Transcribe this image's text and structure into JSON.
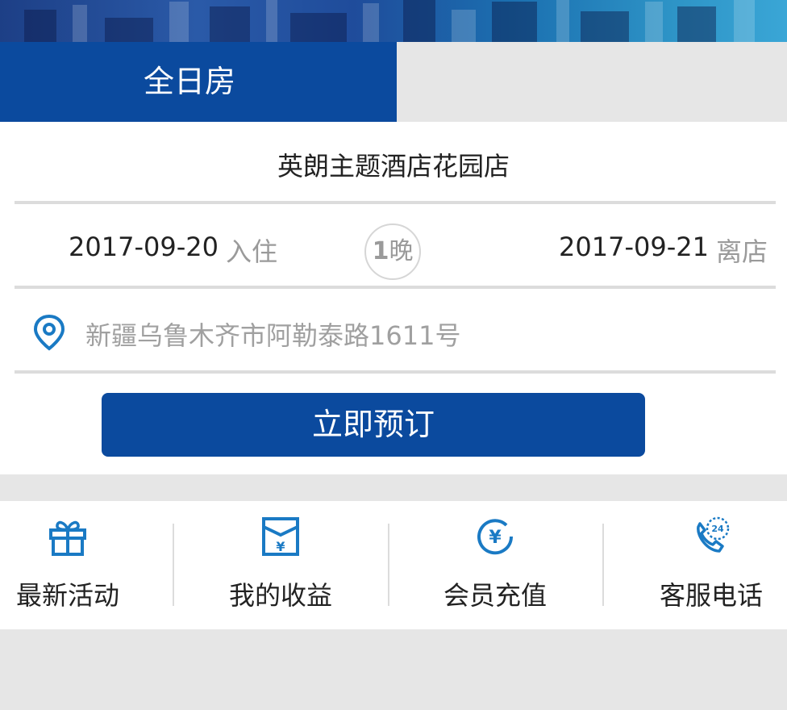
{
  "tabs": {
    "active_label": "全日房"
  },
  "hotel": {
    "name": "英朗主题酒店花园店"
  },
  "stay": {
    "checkin_date": "2017-09-20",
    "checkin_label": "入住",
    "nights_count": "1",
    "nights_unit": "晚",
    "checkout_date": "2017-09-21",
    "checkout_label": "离店"
  },
  "address": {
    "text": "新疆乌鲁木齐市阿勒泰路1611号",
    "icon": "location-pin-icon"
  },
  "book_button": {
    "label": "立即预订"
  },
  "menu": {
    "items": [
      {
        "label": "最新活动",
        "icon": "gift-icon"
      },
      {
        "label": "我的收益",
        "icon": "yen-envelope-icon"
      },
      {
        "label": "会员充值",
        "icon": "yen-coin-icon"
      },
      {
        "label": "客服电话",
        "icon": "phone-24h-icon"
      }
    ]
  },
  "colors": {
    "primary": "#0b4a9e",
    "icon": "#1a7ac4",
    "muted_text": "#9a9a9a",
    "background": "#e6e6e6"
  }
}
